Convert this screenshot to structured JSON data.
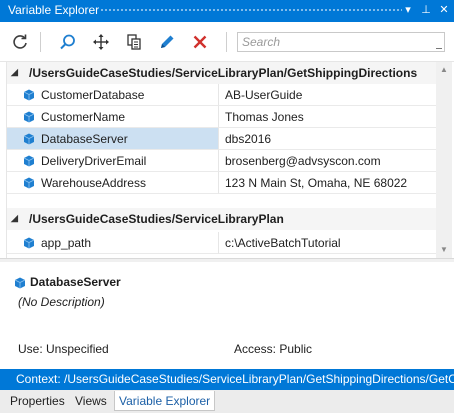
{
  "window": {
    "title": "Variable Explorer",
    "buttons": [
      "▾",
      "⊥",
      "✕"
    ]
  },
  "toolbar": {
    "icons": [
      "refresh-icon",
      "search-icon",
      "move-icon",
      "copy-icon",
      "edit-icon",
      "delete-icon"
    ],
    "search_placeholder": "Search"
  },
  "groups": [
    {
      "label": "/UsersGuideCaseStudies/ServiceLibraryPlan/GetShippingDirections",
      "rows": [
        {
          "name": "CustomerDatabase",
          "value": "AB-UserGuide"
        },
        {
          "name": "CustomerName",
          "value": "Thomas Jones"
        },
        {
          "name": "DatabaseServer",
          "value": "dbs2016"
        },
        {
          "name": "DeliveryDriverEmail",
          "value": "brosenberg@advsyscon.com"
        },
        {
          "name": "WarehouseAddress",
          "value": "123 N Main St, Omaha, NE 68022"
        }
      ]
    },
    {
      "label": "/UsersGuideCaseStudies/ServiceLibraryPlan",
      "rows": [
        {
          "name": "app_path",
          "value": "c:\\ActiveBatchTutorial"
        }
      ]
    }
  ],
  "selected": "DatabaseServer",
  "details": {
    "name": "DatabaseServer",
    "description": "(No Description)",
    "use": "Use: Unspecified",
    "access": "Access: Public"
  },
  "context": "Context: /UsersGuideCaseStudies/ServiceLibraryPlan/GetShippingDirections/GetC",
  "tabs": [
    "Properties",
    "Views",
    "Variable Explorer"
  ],
  "colors": {
    "accent": "#0078d7",
    "selection": "#cce0f2",
    "variable_icon": "#1f7fd0",
    "delete": "#d0312d"
  }
}
